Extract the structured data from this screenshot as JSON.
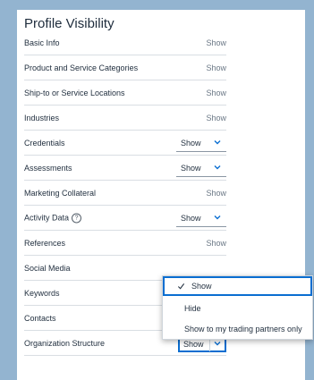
{
  "page": {
    "title": "Profile Visibility"
  },
  "rows": [
    {
      "label": "Basic Info",
      "value": "Show",
      "control": "static"
    },
    {
      "label": "Product and Service Categories",
      "value": "Show",
      "control": "static"
    },
    {
      "label": "Ship-to or Service Locations",
      "value": "Show",
      "control": "static"
    },
    {
      "label": "Industries",
      "value": "Show",
      "control": "static"
    },
    {
      "label": "Credentials",
      "value": "Show",
      "control": "select"
    },
    {
      "label": "Assessments",
      "value": "Show",
      "control": "select"
    },
    {
      "label": "Marketing Collateral",
      "value": "Show",
      "control": "static"
    },
    {
      "label": "Activity Data",
      "value": "Show",
      "control": "select",
      "help_icon": "question-circle-icon"
    },
    {
      "label": "References",
      "value": "Show",
      "control": "static"
    },
    {
      "label": "Social Media",
      "value": "",
      "control": "static"
    },
    {
      "label": "Keywords",
      "value": "",
      "control": "static"
    },
    {
      "label": "Contacts",
      "value": "",
      "control": "static"
    },
    {
      "label": "Organization Structure",
      "value": "Show",
      "control": "select-open"
    }
  ],
  "dropdown": {
    "options": [
      {
        "label": "Show",
        "selected": true,
        "icon": "check-icon"
      },
      {
        "label": "Hide",
        "selected": false
      },
      {
        "label": "Show to my trading partners only",
        "selected": false
      }
    ]
  },
  "colors": {
    "accent": "#0a6ed1",
    "background": "#93b4d0"
  }
}
